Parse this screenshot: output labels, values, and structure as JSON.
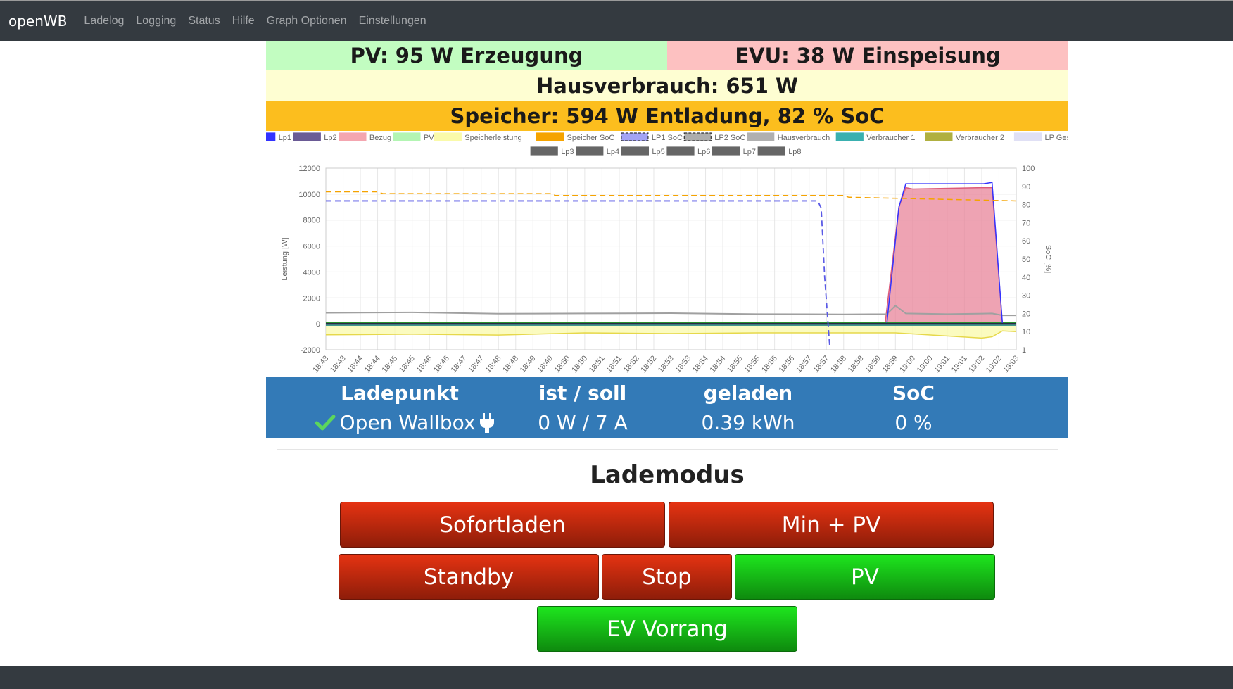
{
  "nav": {
    "brand": "openWB",
    "links": [
      "Ladelog",
      "Logging",
      "Status",
      "Hilfe",
      "Graph Optionen",
      "Einstellungen"
    ]
  },
  "banners": {
    "pv": "PV: 95 W Erzeugung",
    "evu": "EVU: 38 W Einspeisung",
    "haus": "Hausverbrauch: 651 W",
    "speicher": "Speicher: 594 W Entladung, 82 % SoC"
  },
  "colors": {
    "pv_bg": "#c2fdc1",
    "evu_bg": "#fdc1c1",
    "haus_bg": "#fefed2",
    "speicher_bg": "#fcbe1e",
    "table_bg": "#337ab7",
    "btn_red": "#c42a0e",
    "btn_green": "#16b816"
  },
  "table": {
    "headers": [
      "Ladepunkt",
      "ist / soll",
      "geladen",
      "SoC"
    ],
    "row": {
      "status_icon": "check-icon",
      "name": "Open Wallbox",
      "plug_icon": "plug-icon",
      "ist_soll": "0 W / 7 A",
      "geladen": "0.39 kWh",
      "soc": "0 %"
    }
  },
  "lademodus": {
    "title": "Lademodus",
    "buttons": {
      "sofortladen": "Sofortladen",
      "min_pv": "Min + PV",
      "standby": "Standby",
      "stop": "Stop",
      "pv": "PV",
      "ev_vorrang": "EV Vorrang"
    }
  },
  "chart_data": {
    "type": "line",
    "legend": [
      {
        "name": "Lp1",
        "color": "#3333ff",
        "dashed": false
      },
      {
        "name": "Lp2",
        "color": "#6b5b95",
        "dashed": false
      },
      {
        "name": "Bezug",
        "color": "#f4a6b0",
        "dashed": false
      },
      {
        "name": "PV",
        "color": "#b3f5b3",
        "dashed": false
      },
      {
        "name": "Speicherleistung",
        "color": "#fafaaa",
        "dashed": false
      },
      {
        "name": "Speicher SoC",
        "color": "#f5a300",
        "dashed": false
      },
      {
        "name": "LP1 SoC",
        "color": "#6666ee",
        "dashed": true
      },
      {
        "name": "LP2 SoC",
        "color": "#777777",
        "dashed": true
      },
      {
        "name": "Hausverbrauch",
        "color": "#b0b0b0",
        "dashed": false
      },
      {
        "name": "Verbraucher 1",
        "color": "#3ab0b0",
        "dashed": false
      },
      {
        "name": "Verbraucher 2",
        "color": "#b0b040",
        "dashed": false
      },
      {
        "name": "LP Gesamt",
        "color": "#e0e0f5",
        "dashed": false
      },
      {
        "name": "Lp3",
        "color": "#666666",
        "dashed": false
      },
      {
        "name": "Lp4",
        "color": "#666666",
        "dashed": false
      },
      {
        "name": "Lp5",
        "color": "#666666",
        "dashed": false
      },
      {
        "name": "Lp6",
        "color": "#666666",
        "dashed": false
      },
      {
        "name": "Lp7",
        "color": "#666666",
        "dashed": false
      },
      {
        "name": "Lp8",
        "color": "#666666",
        "dashed": false
      }
    ],
    "ylabel_left": "Leistung [W]",
    "ylabel_right": "SoC [%]",
    "ylim_left": [
      -2000,
      12000
    ],
    "ylim_right": [
      0,
      100
    ],
    "yticks_left": [
      "12000",
      "10000",
      "8000",
      "6000",
      "4000",
      "2000",
      "0",
      "-2000"
    ],
    "yticks_right": [
      "100",
      "90",
      "80",
      "70",
      "60",
      "50",
      "40",
      "30",
      "20",
      "10",
      "1"
    ],
    "xticks": [
      "18:43",
      "18:43",
      "18:44",
      "18:44",
      "18:45",
      "18:45",
      "18:46",
      "18:46",
      "18:47",
      "18:47",
      "18:48",
      "18:48",
      "18:49",
      "18:49",
      "18:50",
      "18:50",
      "18:51",
      "18:51",
      "18:52",
      "18:52",
      "18:53",
      "18:53",
      "18:54",
      "18:54",
      "18:55",
      "18:55",
      "18:56",
      "18:56",
      "18:57",
      "18:57",
      "18:58",
      "18:58",
      "18:59",
      "18:59",
      "19:00",
      "19:00",
      "19:01",
      "19:01",
      "19:02",
      "19:02",
      "19:03"
    ],
    "series": [
      {
        "name": "Lp1",
        "x": [
          0,
          32.5,
          33.2,
          33.6,
          38.1,
          38.6,
          39.2,
          40
        ],
        "y": [
          0,
          0,
          9000,
          10800,
          10800,
          10900,
          0,
          0
        ]
      },
      {
        "name": "Bezug",
        "x": [
          0,
          32.4,
          33.2,
          33.6,
          34,
          38,
          38.6,
          39.2,
          40
        ],
        "y": [
          0,
          0,
          9000,
          10500,
          10400,
          10500,
          10500,
          0,
          0
        ]
      },
      {
        "name": "Speicherleistung",
        "x": [
          0,
          5,
          10,
          15,
          20,
          25,
          30,
          32.5,
          33,
          38,
          38.6,
          39.2,
          40
        ],
        "y": [
          -850,
          -800,
          -870,
          -700,
          -750,
          -700,
          -700,
          -700,
          -700,
          -1100,
          -1000,
          -550,
          -600
        ]
      },
      {
        "name": "Hausverbrauch",
        "x": [
          0,
          5,
          10,
          15,
          20,
          25,
          30,
          32.5,
          33,
          33.6,
          36,
          38.6,
          39.2,
          40
        ],
        "y": [
          850,
          880,
          780,
          800,
          820,
          750,
          730,
          750,
          1400,
          800,
          750,
          800,
          650,
          650
        ]
      },
      {
        "name": "PV",
        "x": [
          0,
          40
        ],
        "y": [
          100,
          100
        ]
      },
      {
        "name": "Speicher SoC",
        "x": [
          0,
          3,
          3.3,
          13,
          13.3,
          30,
          30.3,
          40
        ],
        "y": [
          87,
          87,
          86,
          86,
          85,
          85,
          84,
          82
        ]
      },
      {
        "name": "LP1 SoC",
        "x": [
          0,
          28.5,
          28.7,
          28.9,
          29.2
        ],
        "y": [
          82,
          82,
          78,
          40,
          1
        ]
      }
    ]
  }
}
